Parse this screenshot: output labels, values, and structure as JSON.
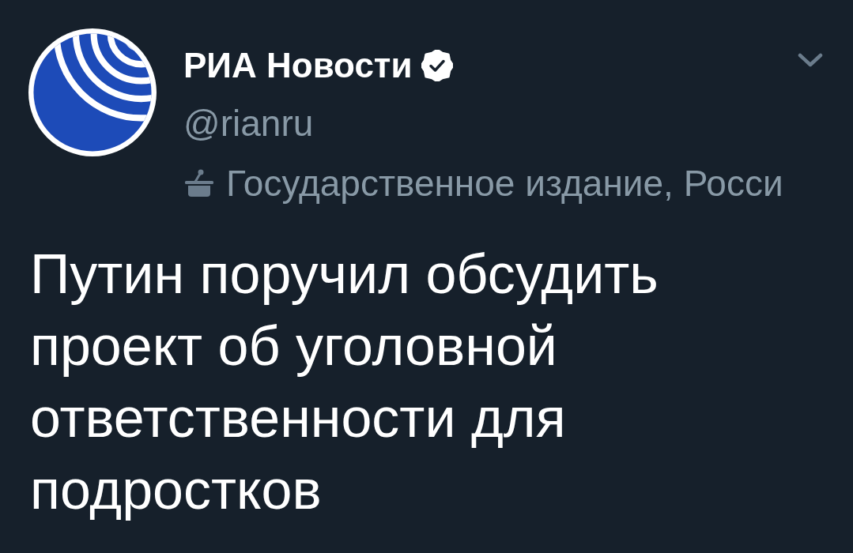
{
  "tweet": {
    "author": {
      "name": "РИА Новости",
      "verified": true,
      "handle": "@rianru",
      "label": "Государственное издание, Росси"
    },
    "text": "Путин поручил обсудить проект об уголовной ответственности для подростков"
  }
}
